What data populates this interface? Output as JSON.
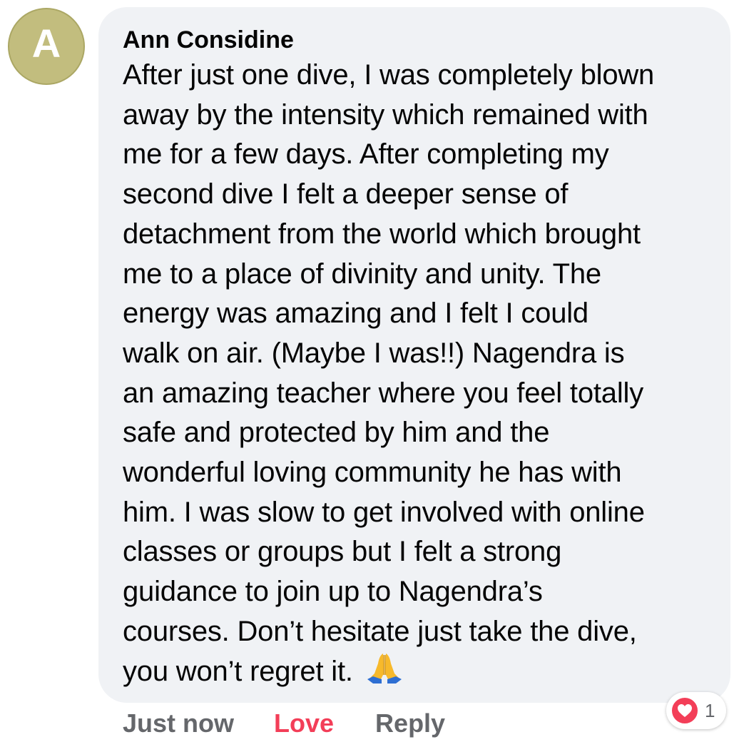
{
  "comment": {
    "avatar_letter": "A",
    "author": "Ann Considine",
    "text": "After just one dive, I was completely blown\naway by the intensity which remained with\nme for a few days. After completing my\nsecond dive I felt a deeper sense of\ndetachment from the world which brought\nme to a place of divinity and unity. The\nenergy was amazing and I felt I could\nwalk on air. (Maybe I was!!) Nagendra is\nan amazing teacher where you feel totally\nsafe and protected by him and the\nwonderful loving community he has with\nhim. I was slow to get involved with online\nclasses or groups but I felt a strong\nguidance to join up to Nagendra’s\ncourses.  Don’t hesitate just take the dive,\nyou won’t regret it.",
    "emoji_icon": "folded-hands-icon"
  },
  "actions": {
    "timestamp": "Just now",
    "love_label": "Love",
    "reply_label": "Reply"
  },
  "reactions": {
    "icon": "heart-icon",
    "count": "1"
  },
  "colors": {
    "bubble": "#f0f2f5",
    "avatar": "#c2bd7e",
    "love": "#f33e58",
    "secondary_text": "#65676b"
  }
}
